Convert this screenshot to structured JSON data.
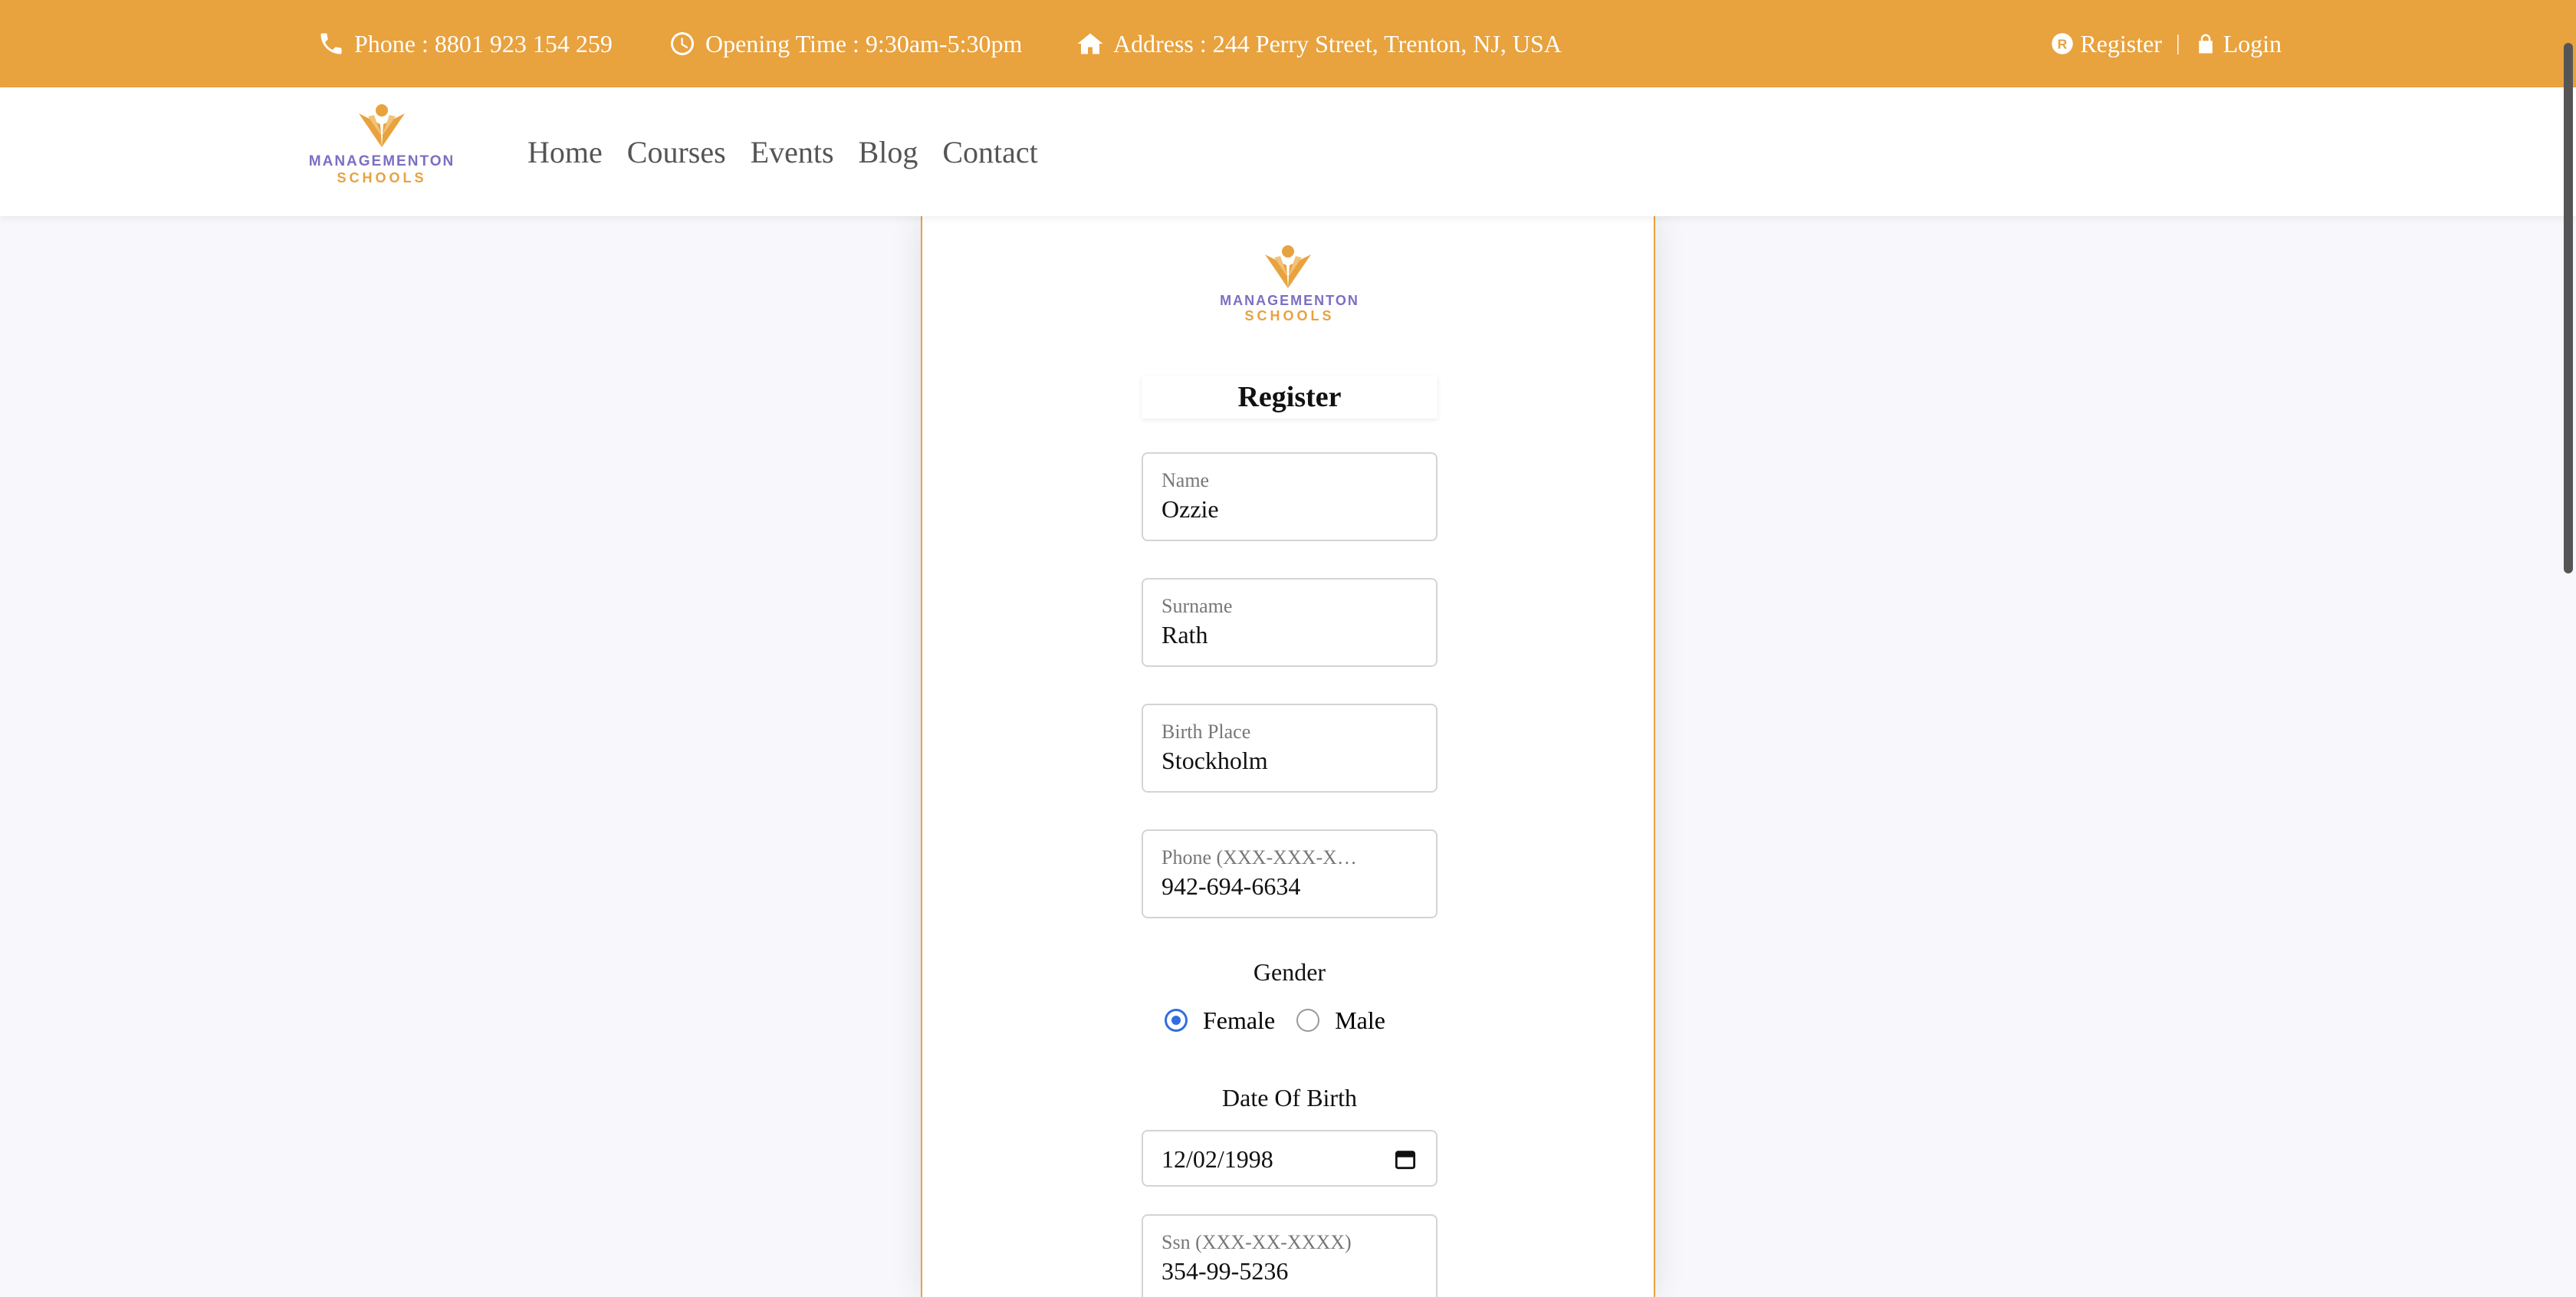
{
  "topbar": {
    "phone_label": "Phone :",
    "phone_value": "8801 923 154 259",
    "hours_label": "Opening Time :",
    "hours_value": "9:30am-5:30pm",
    "address_label": "Address :",
    "address_value": "244 Perry Street, Trenton, NJ, USA",
    "register_label": "Register",
    "separator": "|",
    "login_label": "Login",
    "icons": [
      "phone-icon",
      "clock-icon",
      "home-icon",
      "register-icon",
      "lock-icon"
    ]
  },
  "brand": {
    "line1": "MANAGEMENTON",
    "line2": "SCHOOLS",
    "colors": {
      "primary": "#e8a23e",
      "secondary": "#7b6fc2"
    }
  },
  "nav": {
    "items": [
      {
        "label": "Home"
      },
      {
        "label": "Courses"
      },
      {
        "label": "Events"
      },
      {
        "label": "Blog"
      },
      {
        "label": "Contact"
      }
    ]
  },
  "form": {
    "title": "Register",
    "fields": [
      {
        "label": "Name",
        "value": "Ozzie"
      },
      {
        "label": "Surname",
        "value": "Rath"
      },
      {
        "label": "Birth Place",
        "value": "Stockholm"
      },
      {
        "label": "Phone (XXX-XXX-X…",
        "value": "942-694-6634"
      }
    ],
    "gender": {
      "label": "Gender",
      "options": [
        {
          "label": "Female",
          "selected": true
        },
        {
          "label": "Male",
          "selected": false
        }
      ]
    },
    "dob": {
      "label": "Date Of Birth",
      "value": "12/02/1998"
    },
    "ssn": {
      "label": "Ssn (XXX-XX-XXXX)",
      "value": "354-99-5236"
    }
  }
}
